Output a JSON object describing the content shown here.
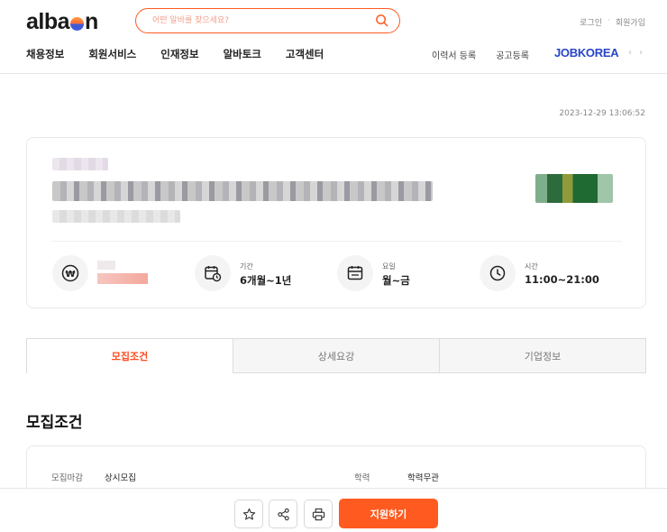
{
  "header": {
    "logo_left": "alba",
    "logo_right": "n",
    "search_placeholder": "어떤 알바를 찾으세요?",
    "login": "로그인",
    "signup": "회원가입",
    "nav": [
      "채용정보",
      "회원서비스",
      "인재정보",
      "알바토크",
      "고객센터"
    ],
    "nav_right": [
      "이력서 등록",
      "공고등록"
    ],
    "partner": "JOBKOREA"
  },
  "posted_at": "2023-12-29 13:06:52",
  "job": {
    "info": [
      {
        "icon": "won-icon",
        "label": "",
        "value": ""
      },
      {
        "icon": "calendar-clock-icon",
        "label": "기간",
        "value": "6개월~1년"
      },
      {
        "icon": "calendar-icon",
        "label": "요일",
        "value": "월~금"
      },
      {
        "icon": "clock-icon",
        "label": "시간",
        "value": "11:00~21:00"
      }
    ]
  },
  "tabs": [
    {
      "label": "모집조건",
      "active": true
    },
    {
      "label": "상세요강",
      "active": false
    },
    {
      "label": "기업정보",
      "active": false
    }
  ],
  "section_title": "모집조건",
  "conditions": [
    {
      "key": "모집마감",
      "value": "상시모집"
    },
    {
      "key": "학력",
      "value": "학력무관"
    }
  ],
  "bottom": {
    "apply_label": "지원하기"
  },
  "colors": {
    "accent": "#ff5a1f",
    "partner": "#2845c8"
  }
}
